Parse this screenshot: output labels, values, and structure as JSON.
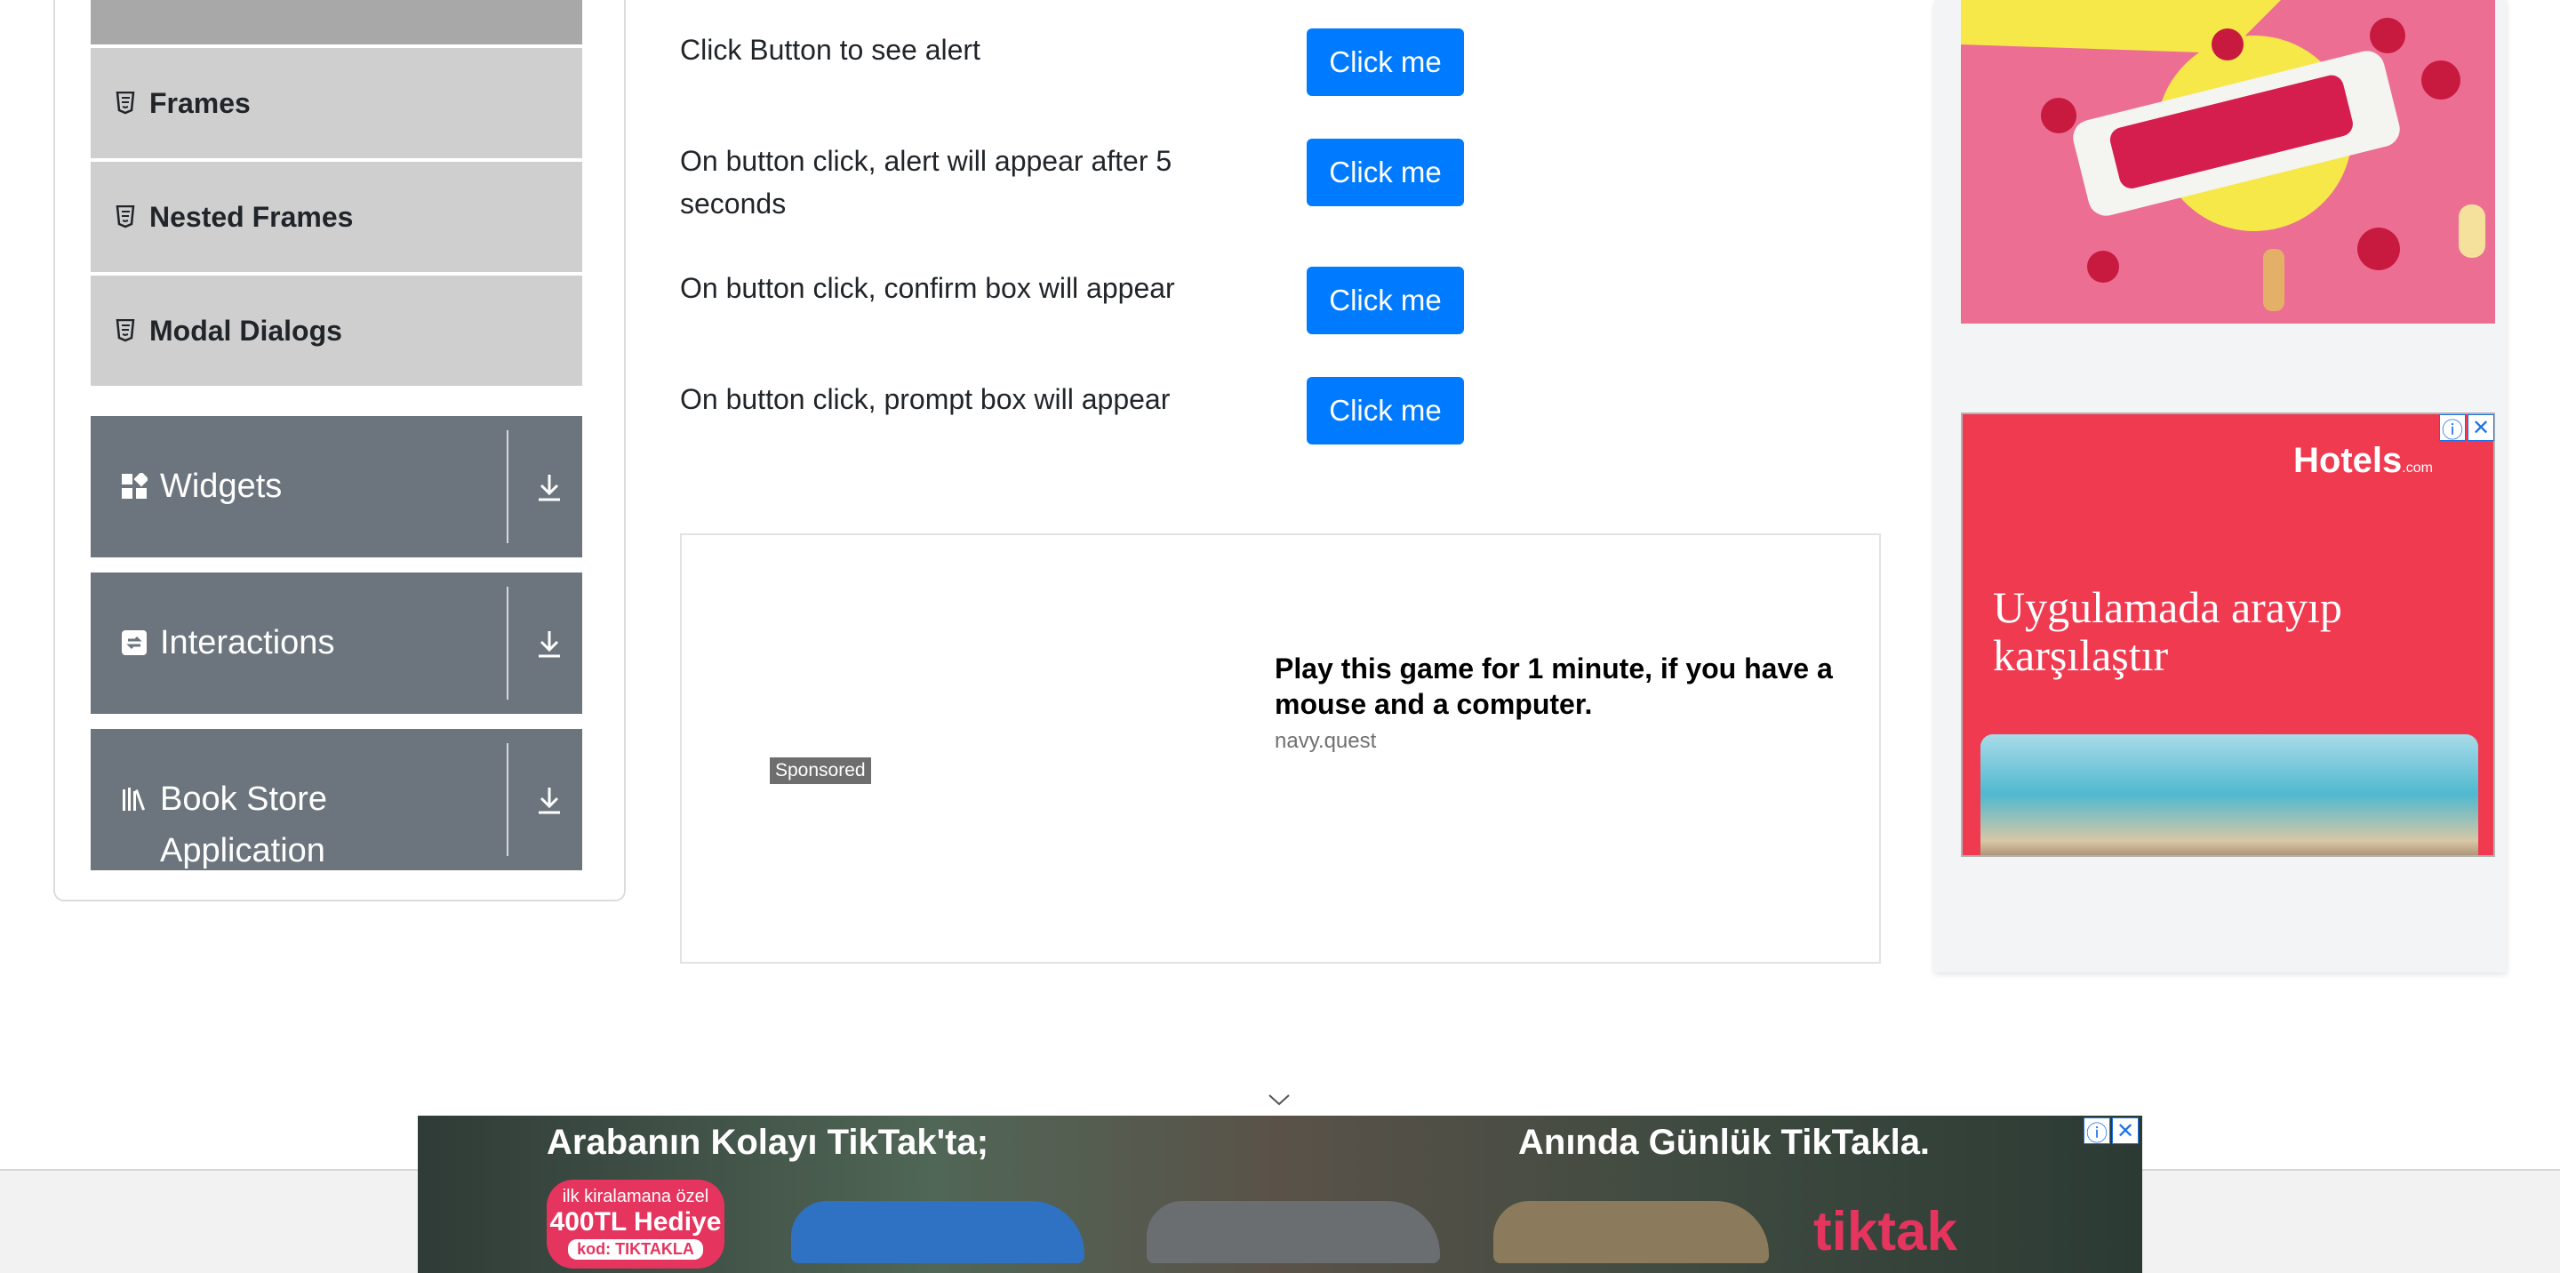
{
  "sidebar": {
    "subitems": [
      {
        "label": "Frames"
      },
      {
        "label": "Nested Frames"
      },
      {
        "label": "Modal Dialogs"
      }
    ],
    "groups": [
      {
        "label": "Widgets",
        "icon": "widgets-icon"
      },
      {
        "label": "Interactions",
        "icon": "interactions-icon"
      },
      {
        "label": "Book Store Application",
        "icon": "bookstore-icon"
      }
    ]
  },
  "alerts": {
    "rows": [
      {
        "text": "Click Button to see alert",
        "button": "Click me"
      },
      {
        "text": "On button click, alert will appear after 5 seconds",
        "button": "Click me"
      },
      {
        "text": "On button click, confirm box will appear",
        "button": "Click me"
      },
      {
        "text": "On button click, prompt box will appear",
        "button": "Click me"
      }
    ]
  },
  "ad_main": {
    "sponsored": "Sponsored",
    "headline": "Play this game for 1 minute, if you have a mouse and a computer.",
    "domain": "navy.quest"
  },
  "ad_side_2": {
    "brand": "Hotels",
    "brand_suffix": ".com",
    "headline": "Uygulamada arayıp karşılaştır"
  },
  "ad_bottom": {
    "left_text": "Arabanın Kolayı TikTak'ta;",
    "right_text": "Anında Günlük TikTakla.",
    "promo_line1": "ilk kiralamana özel",
    "promo_line2": "400TL Hediye",
    "promo_code": "kod: TIKTAKLA",
    "logo": "tiktak"
  },
  "colors": {
    "primary_button": "#007bff",
    "group_bg": "#6c757d",
    "subitem_bg": "#cfcfcf"
  }
}
